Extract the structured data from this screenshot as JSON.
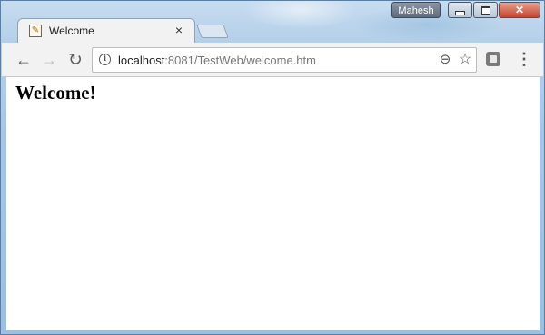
{
  "window": {
    "user": "Mahesh",
    "close_glyph": "✕"
  },
  "tab": {
    "title": "Welcome",
    "close_glyph": "×"
  },
  "toolbar": {
    "back_glyph": "←",
    "forward_glyph": "→",
    "reload_glyph": "↻",
    "url_host": "localhost",
    "url_rest": ":8081/TestWeb/welcome.htm",
    "menu_glyph": "⋮"
  },
  "page": {
    "heading": "Welcome!"
  },
  "icons": {
    "favicon": "tomcat-favicon-icon",
    "info": "info-icon",
    "zoom": "zoom-out-icon",
    "bookmark": "star-icon",
    "extension": "extension-icon"
  },
  "colors": {
    "frame": "#a8c6e4",
    "toolbar": "#f2f2f2",
    "close_button": "#c7432b"
  }
}
